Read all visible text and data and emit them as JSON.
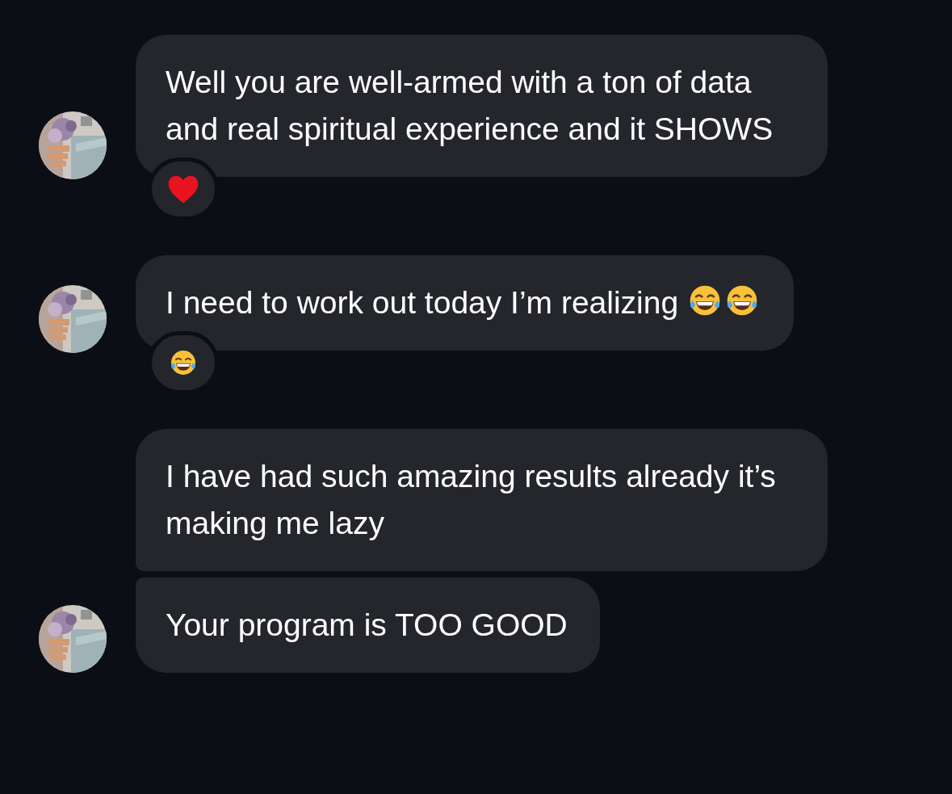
{
  "groups": [
    {
      "avatar": {
        "kind": "picture"
      },
      "messages": [
        {
          "text": "Well you are well-armed with a ton of data and real spiritual experience and it SHOWS",
          "reaction": {
            "kind": "heart"
          }
        }
      ]
    },
    {
      "avatar": {
        "kind": "picture"
      },
      "messages": [
        {
          "text": "I need to work out today I’m realizing",
          "emojis": [
            {
              "kind": "laugh"
            },
            {
              "kind": "laugh"
            }
          ],
          "reaction": {
            "kind": "laugh"
          }
        }
      ]
    },
    {
      "avatar": {
        "kind": "picture"
      },
      "messages": [
        {
          "text": "I have had such amazing results already it’s making me lazy"
        },
        {
          "text": "Your program is TOO GOOD"
        }
      ]
    }
  ]
}
